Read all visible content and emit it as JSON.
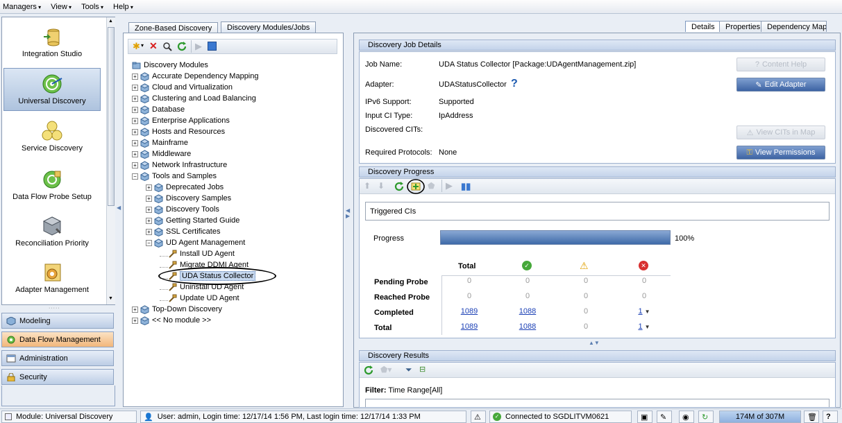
{
  "menu": [
    "Managers",
    "View",
    "Tools",
    "Help"
  ],
  "sidebar": {
    "items": [
      {
        "label": "Integration Studio"
      },
      {
        "label": "Universal Discovery"
      },
      {
        "label": "Service Discovery"
      },
      {
        "label": "Data Flow Probe Setup"
      },
      {
        "label": "Reconciliation Priority"
      },
      {
        "label": "Adapter Management"
      }
    ],
    "bottom_tabs": [
      {
        "label": "Modeling"
      },
      {
        "label": "Data Flow Management"
      },
      {
        "label": "Administration"
      },
      {
        "label": "Security"
      }
    ]
  },
  "middle": {
    "tabs": [
      "Zone-Based Discovery",
      "Discovery Modules/Jobs"
    ],
    "tree_root": "Discovery Modules",
    "tree": [
      "Accurate Dependency Mapping",
      "Cloud and Virtualization",
      "Clustering and Load Balancing",
      "Database",
      "Enterprise Applications",
      "Hosts and Resources",
      "Mainframe",
      "Middleware",
      "Network Infrastructure",
      "Tools and Samples"
    ],
    "tools_children": [
      "Deprecated Jobs",
      "Discovery Samples",
      "Discovery Tools",
      "Getting Started Guide",
      "SSL Certificates",
      "UD Agent Management"
    ],
    "agent_children": [
      "Install UD Agent",
      "Migrate DDMI Agent",
      "UDA Status Collector",
      "Uninstall UD Agent",
      "Update UD Agent"
    ],
    "tail": [
      "Top-Down Discovery",
      "<< No module >>"
    ]
  },
  "right": {
    "tabs": [
      "Details",
      "Properties",
      "Dependency Map"
    ],
    "job_details": {
      "title": "Discovery Job Details",
      "job_name_label": "Job Name:",
      "job_name": "UDA Status Collector [Package:UDAgentManagement.zip]",
      "adapter_label": "Adapter:",
      "adapter": "UDAStatusCollector",
      "ipv6_label": "IPv6 Support:",
      "ipv6": "Supported",
      "input_ci_label": "Input CI Type:",
      "input_ci": "IpAddress",
      "discovered_label": "Discovered CITs:",
      "protocols_label": "Required Protocols:",
      "protocols": "None",
      "btn_content_help": "Content Help",
      "btn_edit_adapter": "Edit Adapter",
      "btn_view_cits": "View CITs in Map",
      "btn_view_permissions": "View Permissions"
    },
    "progress": {
      "title": "Discovery Progress",
      "triggered": "Triggered CIs",
      "progress_label": "Progress",
      "progress_value": "100%",
      "progress_fraction": 1.0,
      "col_total": "Total",
      "rows": [
        {
          "label": "Pending Probe",
          "total": "0",
          "ok": "0",
          "warn": "0",
          "err": "0"
        },
        {
          "label": "Reached Probe",
          "total": "0",
          "ok": "0",
          "warn": "0",
          "err": "0"
        },
        {
          "label": "Completed",
          "total": "1089",
          "ok": "1088",
          "warn": "0",
          "err": "1"
        },
        {
          "label": "Total",
          "total": "1089",
          "ok": "1088",
          "warn": "0",
          "err": "1"
        }
      ]
    },
    "results": {
      "title": "Discovery Results",
      "filter_label": "Filter:",
      "filter_value": "Time Range[All]"
    }
  },
  "status": {
    "module": "Module: Universal Discovery",
    "user": "User: admin, Login time: 12/17/14 1:56 PM, Last login time: 12/17/14 1:33 PM",
    "connection": "Connected to SGDLITVM0621",
    "memory": "174M of 307M"
  }
}
